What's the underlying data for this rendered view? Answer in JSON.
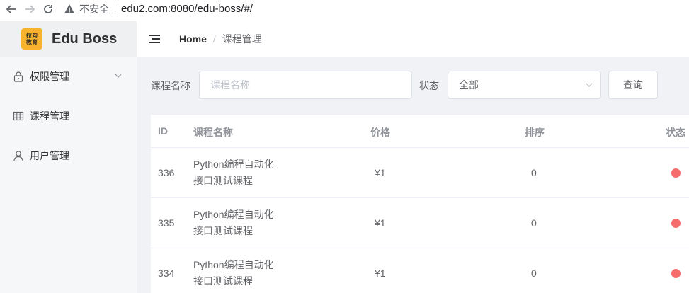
{
  "browser": {
    "insecure_label": "不安全",
    "url": "edu2.com:8080/edu-boss/#/"
  },
  "sidebar": {
    "logo_line1": "拉勾",
    "logo_line2": "教育",
    "brand": "Edu Boss",
    "items": [
      {
        "label": "权限管理",
        "icon": "lock-icon",
        "expandable": true
      },
      {
        "label": "课程管理",
        "icon": "grid-icon"
      },
      {
        "label": "用户管理",
        "icon": "user-icon"
      }
    ]
  },
  "header": {
    "breadcrumb_home": "Home",
    "breadcrumb_separator": "/",
    "breadcrumb_current": "课程管理"
  },
  "filter": {
    "name_label": "课程名称",
    "name_placeholder": "课程名称",
    "status_label": "状态",
    "status_value": "全部",
    "query_button": "查询"
  },
  "table": {
    "columns": [
      "ID",
      "课程名称",
      "价格",
      "排序",
      "状态"
    ],
    "rows": [
      {
        "id": "336",
        "name_line1": "Python编程自动化",
        "name_line2": "接口测试课程",
        "price": "¥1",
        "sort": "0",
        "status_color": "#f56c6c"
      },
      {
        "id": "335",
        "name_line1": "Python编程自动化",
        "name_line2": "接口测试课程",
        "price": "¥1",
        "sort": "0",
        "status_color": "#f56c6c"
      },
      {
        "id": "334",
        "name_line1": "Python编程自动化",
        "name_line2": "接口测试课程",
        "price": "¥1",
        "sort": "0",
        "status_color": "#f56c6c"
      }
    ]
  }
}
